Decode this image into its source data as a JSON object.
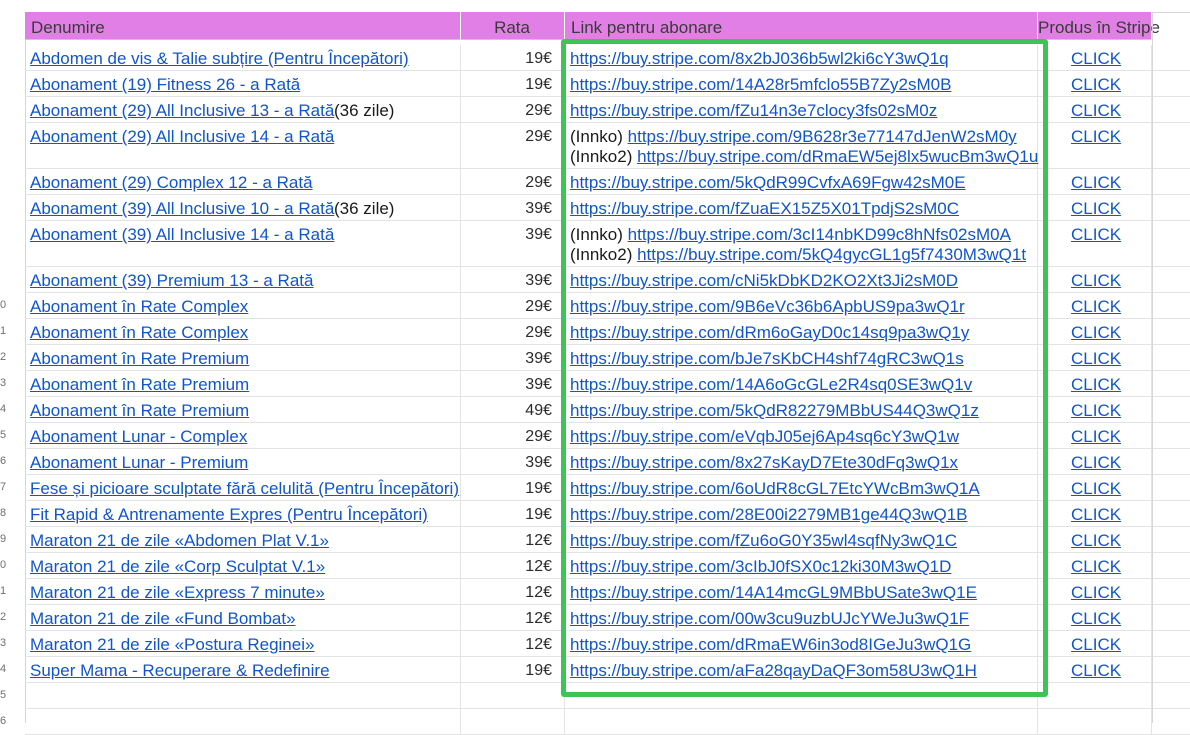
{
  "header": {
    "col_name": "Denumire",
    "col_rate": "Rata",
    "col_link": "Link pentru abonare",
    "col_stripe": "Produs în Stripe"
  },
  "rows": [
    {
      "num": "",
      "name": "Abdomen de vis & Talie subțire (Pentru Începători)",
      "extra": "",
      "rate": "19€",
      "links": [
        {
          "prefix": "",
          "url": "https://buy.stripe.com/8x2bJ036b5wl2ki6cY3wQ1q"
        }
      ],
      "click": "CLICK"
    },
    {
      "num": "",
      "name": "Abonament (19) Fitness 26 - a Rată",
      "extra": "",
      "rate": "19€",
      "links": [
        {
          "prefix": "",
          "url": "https://buy.stripe.com/14A28r5mfclo55B7Zy2sM0B"
        }
      ],
      "click": "CLICK"
    },
    {
      "num": "",
      "name": "Abonament (29) All Inclusive 13 - a Rată",
      "extra": " (36 zile)",
      "rate": "29€",
      "links": [
        {
          "prefix": "",
          "url": "https://buy.stripe.com/fZu14n3e7clocy3fs02sM0z"
        }
      ],
      "click": "CLICK"
    },
    {
      "num": "",
      "name": "Abonament (29) All Inclusive 14 - a Rată",
      "extra": "",
      "rate": "29€",
      "links": [
        {
          "prefix": "(Innko) ",
          "url": "https://buy.stripe.com/9B628r3e77147dJenW2sM0y"
        },
        {
          "prefix": "(Innko2) ",
          "url": "https://buy.stripe.com/dRmaEW5ej8lx5wucBm3wQ1u"
        }
      ],
      "click": "CLICK"
    },
    {
      "num": "",
      "name": "Abonament (29) Complex 12 - a Rată",
      "extra": "",
      "rate": "29€",
      "links": [
        {
          "prefix": "",
          "url": "https://buy.stripe.com/5kQdR99CvfxA69Fgw42sM0E"
        }
      ],
      "click": "CLICK"
    },
    {
      "num": "",
      "name": "Abonament (39) All Inclusive 10 - a Rată",
      "extra": " (36 zile)",
      "rate": "39€",
      "links": [
        {
          "prefix": "",
          "url": "https://buy.stripe.com/fZuaEX15Z5X01TpdjS2sM0C"
        }
      ],
      "click": "CLICK"
    },
    {
      "num": "",
      "name": "Abonament (39) All Inclusive 14 - a Rată",
      "extra": "",
      "rate": "39€",
      "links": [
        {
          "prefix": "(Innko) ",
          "url": "https://buy.stripe.com/3cI14nbKD99c8hNfs02sM0A"
        },
        {
          "prefix": "(Innko2) ",
          "url": "https://buy.stripe.com/5kQ4gycGL1g5f7430M3wQ1t"
        }
      ],
      "click": "CLICK"
    },
    {
      "num": "",
      "name": "Abonament (39) Premium 13 - a Rată",
      "extra": "",
      "rate": "39€",
      "links": [
        {
          "prefix": "",
          "url": "https://buy.stripe.com/cNi5kDbKD2KO2Xt3Ji2sM0D"
        }
      ],
      "click": "CLICK"
    },
    {
      "num": "0",
      "name": "Abonament în Rate Complex",
      "extra": "",
      "rate": "29€",
      "links": [
        {
          "prefix": "",
          "url": "https://buy.stripe.com/9B6eVc36b6ApbUS9pa3wQ1r"
        }
      ],
      "click": "CLICK"
    },
    {
      "num": "1",
      "name": "Abonament în Rate Complex",
      "extra": "",
      "rate": "29€",
      "links": [
        {
          "prefix": "",
          "url": "https://buy.stripe.com/dRm6oGayD0c14sq9pa3wQ1y"
        }
      ],
      "click": "CLICK"
    },
    {
      "num": "2",
      "name": "Abonament în Rate Premium",
      "extra": "",
      "rate": "39€",
      "links": [
        {
          "prefix": "",
          "url": "https://buy.stripe.com/bJe7sKbCH4shf74gRC3wQ1s"
        }
      ],
      "click": "CLICK"
    },
    {
      "num": "3",
      "name": "Abonament în Rate Premium",
      "extra": "",
      "rate": "39€",
      "links": [
        {
          "prefix": "",
          "url": "https://buy.stripe.com/14A6oGcGLe2R4sq0SE3wQ1v"
        }
      ],
      "click": "CLICK"
    },
    {
      "num": "4",
      "name": "Abonament în Rate Premium",
      "extra": "",
      "rate": "49€",
      "links": [
        {
          "prefix": "",
          "url": "https://buy.stripe.com/5kQdR82279MBbUS44Q3wQ1z"
        }
      ],
      "click": "CLICK"
    },
    {
      "num": "5",
      "name": "Abonament Lunar - Complex",
      "extra": "",
      "rate": "29€",
      "links": [
        {
          "prefix": "",
          "url": "https://buy.stripe.com/eVqbJ05ej6Ap4sq6cY3wQ1w"
        }
      ],
      "click": "CLICK"
    },
    {
      "num": "6",
      "name": "Abonament Lunar - Premium",
      "extra": "",
      "rate": "39€",
      "links": [
        {
          "prefix": "",
          "url": "https://buy.stripe.com/8x27sKayD7Ete30dFq3wQ1x"
        }
      ],
      "click": "CLICK"
    },
    {
      "num": "7",
      "name": "Fese și picioare sculptate fără celulită (Pentru Începători)",
      "extra": "",
      "rate": "19€",
      "links": [
        {
          "prefix": "",
          "url": "https://buy.stripe.com/6oUdR8cGL7EtcYWcBm3wQ1A"
        }
      ],
      "click": "CLICK"
    },
    {
      "num": "8",
      "name": "Fit Rapid & Antrenamente Expres (Pentru Începători)",
      "extra": "",
      "rate": "19€",
      "links": [
        {
          "prefix": "",
          "url": "https://buy.stripe.com/28E00i2279MB1ge44Q3wQ1B"
        }
      ],
      "click": "CLICK"
    },
    {
      "num": "9",
      "name": "Maraton 21 de zile «Abdomen Plat V.1»",
      "extra": "",
      "rate": "12€",
      "links": [
        {
          "prefix": "",
          "url": "https://buy.stripe.com/fZu6oG0Y35wl4sqfNy3wQ1C"
        }
      ],
      "click": "CLICK"
    },
    {
      "num": "0",
      "name": "Maraton 21 de zile «Corp Sculptat V.1»",
      "extra": "",
      "rate": "12€",
      "links": [
        {
          "prefix": "",
          "url": "https://buy.stripe.com/3cIbJ0fSX0c12ki30M3wQ1D"
        }
      ],
      "click": "CLICK"
    },
    {
      "num": "1",
      "name": "Maraton 21 de zile «Express 7 minute»",
      "extra": "",
      "rate": "12€",
      "links": [
        {
          "prefix": "",
          "url": "https://buy.stripe.com/14A14mcGL9MBbUSate3wQ1E"
        }
      ],
      "click": "CLICK"
    },
    {
      "num": "2",
      "name": "Maraton 21 de zile «Fund Bombat»",
      "extra": "",
      "rate": "12€",
      "links": [
        {
          "prefix": "",
          "url": "https://buy.stripe.com/00w3cu9uzbUJcYWeJu3wQ1F"
        }
      ],
      "click": "CLICK"
    },
    {
      "num": "3",
      "name": "Maraton 21 de zile «Postura Reginei»",
      "extra": "",
      "rate": "12€",
      "links": [
        {
          "prefix": "",
          "url": "https://buy.stripe.com/dRmaEW6in3od8IGeJu3wQ1G"
        }
      ],
      "click": "CLICK"
    },
    {
      "num": "4",
      "name": "Super Mama - Recuperare & Redefinire",
      "extra": "",
      "rate": "19€",
      "links": [
        {
          "prefix": "",
          "url": "https://buy.stripe.com/aFa28qayDaQF3om58U3wQ1H"
        }
      ],
      "click": "CLICK"
    },
    {
      "num": "5",
      "name": "",
      "extra": "",
      "rate": "",
      "links": [],
      "click": ""
    },
    {
      "num": "6",
      "name": "",
      "extra": "",
      "rate": "",
      "links": [],
      "click": ""
    }
  ]
}
